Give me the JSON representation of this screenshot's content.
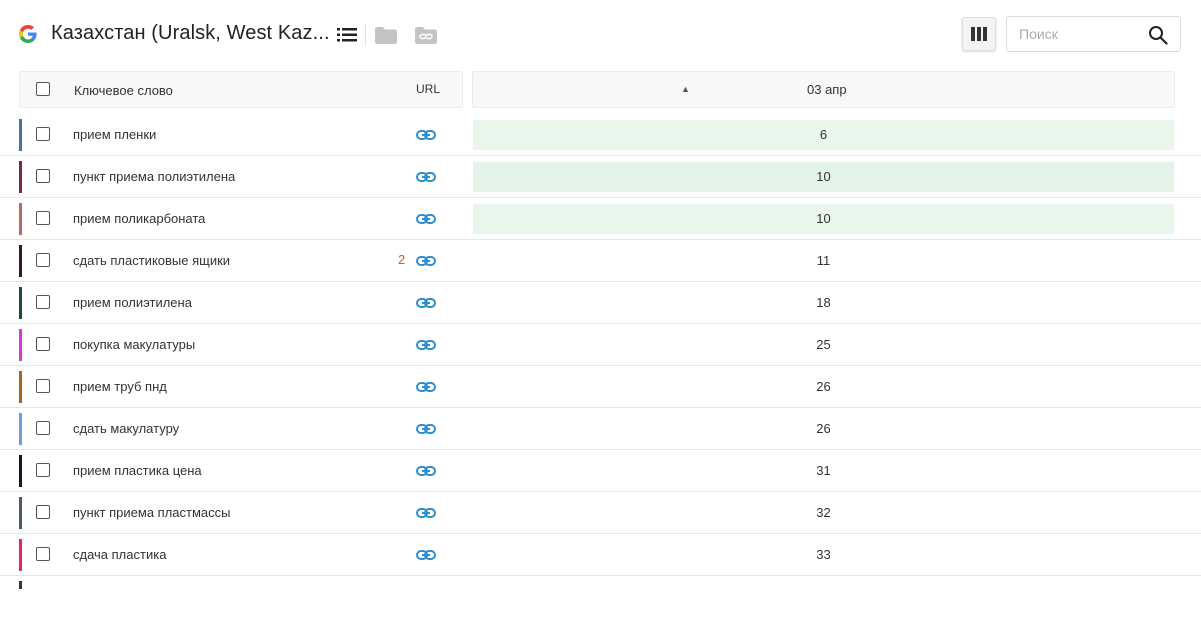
{
  "header": {
    "title": "Казахстан (Uralsk, West Kaz...",
    "search_placeholder": "Поиск"
  },
  "table": {
    "col_keyword": "Ключевое слово",
    "col_url": "URL",
    "sort_indicator": "▲",
    "col_date": "03 апр"
  },
  "rows": [
    {
      "keyword": "прием пленки",
      "color": "#4a6fa5",
      "position": "6",
      "highlight": "#e8f6ec",
      "url_count": ""
    },
    {
      "keyword": "пункт приема полиэтилена",
      "color": "#7a2a3a",
      "position": "10",
      "highlight": "#e4f3e8",
      "url_count": ""
    },
    {
      "keyword": "прием поликарбоната",
      "color": "#b06a6a",
      "position": "10",
      "highlight": "#e8f6ec",
      "url_count": ""
    },
    {
      "keyword": "сдать пластиковые ящики",
      "color": "#3a1a22",
      "position": "11",
      "highlight": "",
      "url_count": "2"
    },
    {
      "keyword": "прием полиэтилена",
      "color": "#1f4a35",
      "position": "18",
      "highlight": "",
      "url_count": ""
    },
    {
      "keyword": "покупка макулатуры",
      "color": "#d63ad6",
      "position": "25",
      "highlight": "",
      "url_count": ""
    },
    {
      "keyword": "прием труб пнд",
      "color": "#a8641e",
      "position": "26",
      "highlight": "",
      "url_count": ""
    },
    {
      "keyword": "сдать макулатуру",
      "color": "#6f9ee0",
      "position": "26",
      "highlight": "",
      "url_count": ""
    },
    {
      "keyword": "прием пластика цена",
      "color": "#0e1a2a",
      "position": "31",
      "highlight": "",
      "url_count": ""
    },
    {
      "keyword": "пункт приема пластмассы",
      "color": "#4a5a6a",
      "position": "32",
      "highlight": "",
      "url_count": ""
    },
    {
      "keyword": "сдача пластика",
      "color": "#e0285a",
      "position": "33",
      "highlight": "",
      "url_count": ""
    }
  ],
  "colors": {
    "link_icon": "#2b8fd0",
    "url_count": "#e74c3c"
  }
}
